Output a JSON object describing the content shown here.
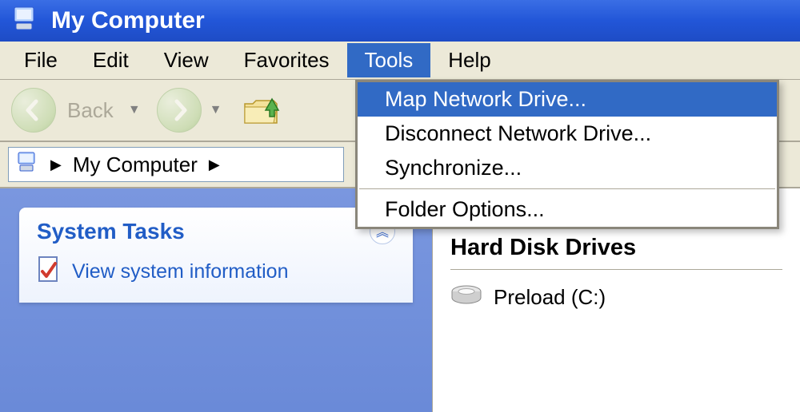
{
  "window": {
    "title": "My Computer"
  },
  "menubar": {
    "items": [
      "File",
      "Edit",
      "View",
      "Favorites",
      "Tools",
      "Help"
    ],
    "active_index": 4
  },
  "toolbar": {
    "back_label": "Back"
  },
  "address": {
    "crumb": "My Computer"
  },
  "sidebar": {
    "panel_title": "System Tasks",
    "tasks": [
      {
        "label": "View system information"
      }
    ]
  },
  "main": {
    "section_title": "Hard Disk Drives",
    "drives": [
      {
        "label": "Preload (C:)"
      }
    ]
  },
  "tools_menu": {
    "items": [
      "Map Network Drive...",
      "Disconnect Network Drive...",
      "Synchronize..."
    ],
    "after_sep": [
      "Folder Options..."
    ],
    "highlight_index": 0
  }
}
